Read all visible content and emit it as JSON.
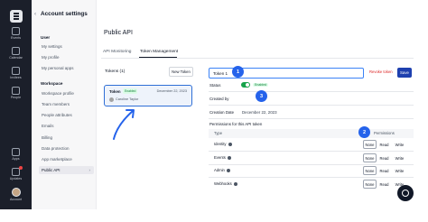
{
  "rail": {
    "items": [
      {
        "label": "Events",
        "icon": "calendar-grid-icon"
      },
      {
        "label": "Calendar",
        "icon": "calendar-icon"
      },
      {
        "label": "Invitees",
        "icon": "invitees-icon"
      },
      {
        "label": "People",
        "icon": "people-icon"
      },
      {
        "label": "Apps",
        "icon": "apps-icon"
      },
      {
        "label": "Updates",
        "icon": "bell-icon"
      },
      {
        "label": "Account",
        "icon": "avatar"
      }
    ]
  },
  "sidebar": {
    "title": "Account settings",
    "user_heading": "User",
    "user_items": [
      "My settings",
      "My profile",
      "My personal apps"
    ],
    "workspace_heading": "Workspace",
    "workspace_items": [
      "Workspace profile",
      "Team members",
      "People attributes",
      "Emails",
      "Billing",
      "Data protection",
      "App marketplace",
      "Public API"
    ]
  },
  "main": {
    "title": "Public API",
    "tabs": [
      "API Monitoring",
      "Token Management"
    ],
    "tokens_label": "Tokens (1)",
    "new_token_label": "New Token",
    "token": {
      "name": "Token",
      "status": "Enabled",
      "date": "December 22, 2023",
      "owner": "Caroline Taylor"
    }
  },
  "detail": {
    "name_value": "Token 1",
    "revoke_label": "Revoke token",
    "save_label": "Save",
    "status_label": "Status",
    "status_value": "Enabled",
    "created_by_label": "Created by",
    "creation_date_label": "Creation Date",
    "creation_date": "December 22, 2023",
    "permissions_title": "Permissions for this API token",
    "col_type": "Type",
    "col_permissions": "Permissions",
    "rows": [
      {
        "type": "Identity",
        "options": [
          "None",
          "Read",
          "Write"
        ],
        "selected": "None"
      },
      {
        "type": "Events",
        "options": [
          "None",
          "Read",
          "Write"
        ],
        "selected": "None"
      },
      {
        "type": "Admin",
        "options": [
          "None",
          "Read",
          "Write"
        ],
        "selected": "None"
      },
      {
        "type": "Webhooks",
        "options": [
          "None",
          "Read",
          "Write"
        ],
        "selected": "None"
      }
    ]
  },
  "annotations": {
    "callout_1": "1",
    "callout_2": "2",
    "callout_3": "3"
  },
  "colors": {
    "accent": "#2563eb",
    "rail": "#1b1f2a",
    "enabled": "#16a34a",
    "revoke": "#dc2626"
  }
}
